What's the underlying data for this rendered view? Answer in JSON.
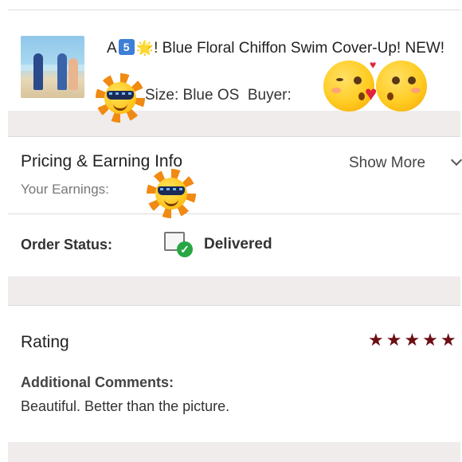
{
  "product": {
    "title_prefix": "A",
    "badge": "5",
    "sparkle": "🌟",
    "title_rest": "! Blue Floral Chiffon Swim Cover-Up! NEW!",
    "size_label": "Size: Blue OS",
    "buyer_label": "Buyer:"
  },
  "pricing": {
    "title": "Pricing & Earning Info",
    "earnings_label": "Your Earnings:",
    "show_more": "Show More"
  },
  "order": {
    "status_label": "Order Status:",
    "status_value": "Delivered"
  },
  "rating": {
    "title": "Rating",
    "stars": "★★★★★",
    "value": 5,
    "comments_label": "Additional Comments:",
    "comment": "Beautiful. Better than the picture."
  },
  "colors": {
    "star": "#6b0f14",
    "delivered_check": "#28a745",
    "gap_band": "#efeceb"
  },
  "icons": [
    "product-thumbnail",
    "sun-sunglasses-emoji",
    "kissing-faces-emoji",
    "package-icon",
    "check-circle-icon",
    "chevron-down-icon",
    "star-icon"
  ]
}
